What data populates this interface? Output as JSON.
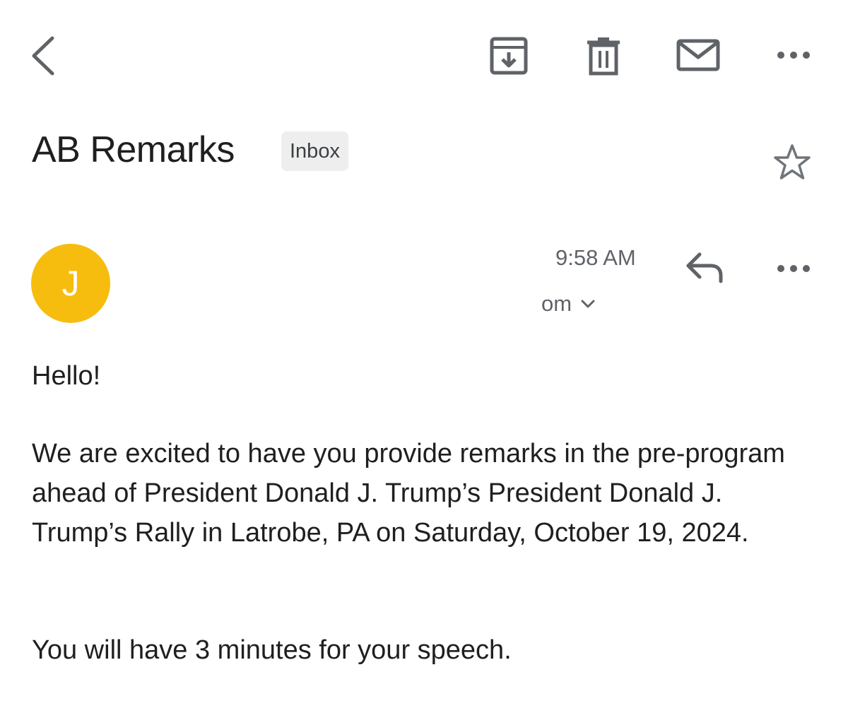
{
  "toolbar": {
    "back_icon": "chevron-left-icon",
    "archive_icon": "archive-icon",
    "delete_icon": "trash-icon",
    "mark_unread_icon": "mail-icon",
    "more_icon": "more-horizontal-icon"
  },
  "email": {
    "subject": "AB Remarks",
    "label": "Inbox",
    "star_icon": "star-outline-icon"
  },
  "sender": {
    "avatar_initial": "J",
    "avatar_color": "#f6bd0f",
    "time": "9:58 AM",
    "address_fragment": "om",
    "details_icon": "chevron-down-icon",
    "reply_icon": "reply-icon",
    "more_icon": "more-horizontal-icon"
  },
  "body": {
    "greeting": "Hello!",
    "paragraph1": "We are excited to have you provide remarks in the pre-program ahead of President Donald J. Trump’s President Donald J. Trump’s Rally in Latrobe, PA on Saturday, October 19, 2024.",
    "paragraph2": "You will have 3 minutes for your speech."
  },
  "colors": {
    "icon_gray": "#5f6368",
    "text": "#1f1f1f",
    "chip_bg": "#eeeeee"
  }
}
